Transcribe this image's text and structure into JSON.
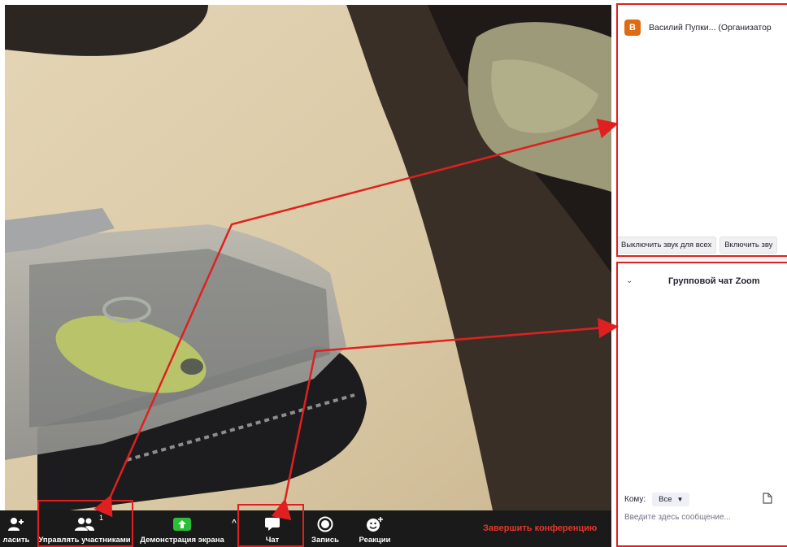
{
  "toolbar": {
    "invite_label": "ласить",
    "participants_label": "Управлять участниками",
    "participants_count": "1",
    "share_label": "Демонстрация экрана",
    "chat_label": "Чат",
    "record_label": "Запись",
    "reactions_label": "Реакции",
    "end_label": "Завершить конференцию"
  },
  "participants": {
    "items": [
      {
        "initial": "В",
        "name": "Василий Пупки... (Организатор",
        "avatar_color": "#e06a14"
      }
    ],
    "mute_all_label": "Выключить звук для всех",
    "unmute_all_label": "Включить зву"
  },
  "chat": {
    "title": "Групповой чат Zoom",
    "to_label": "Кому:",
    "to_value": "Все",
    "input_placeholder": "Введите здесь сообщение..."
  },
  "colors": {
    "annotation_red": "#e02020",
    "end_button": "#e8362b",
    "share_green": "#2bbf36",
    "toolbar_bg": "#1a1a1a"
  }
}
